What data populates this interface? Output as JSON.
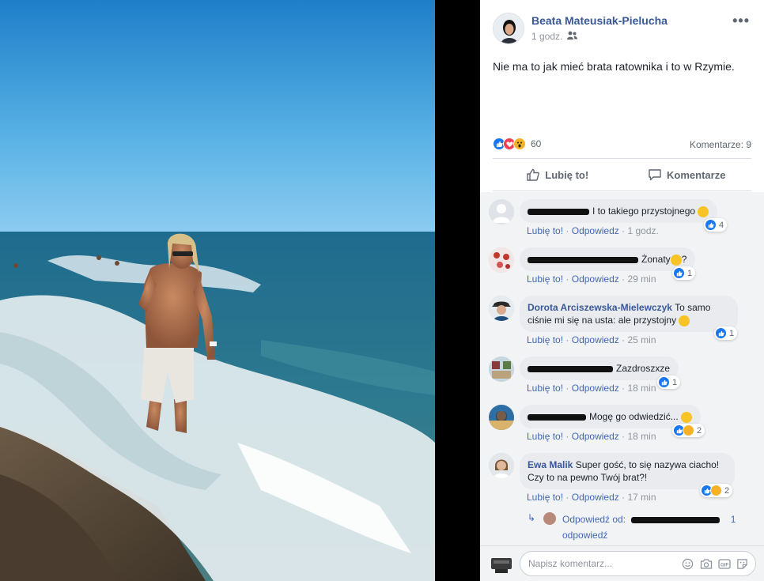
{
  "post": {
    "author": "Beata Mateusiak-Pielucha",
    "time": "1 godz.",
    "text": "Nie ma to jak mieć brata ratownika i to w Rzymie.",
    "reactions_count": "60",
    "comments_label": "Komentarze: 9",
    "like_label": "Lubię to!",
    "comment_label": "Komentarze"
  },
  "comments": [
    {
      "name": "",
      "text": "I to takiego przystojnego",
      "time": "1 godz.",
      "reactions": "4"
    },
    {
      "name": "",
      "text": "Żonaty",
      "suffix": "?",
      "time": "29 min",
      "reactions": "1"
    },
    {
      "name": "Dorota Arciszewska-Mielewczyk",
      "text": "To samo ciśnie mi się na usta: ale przystojny",
      "time": "25 min",
      "reactions": "1"
    },
    {
      "name": "",
      "text": "Zazdroszxze",
      "time": "18 min",
      "reactions": "1"
    },
    {
      "name": "",
      "text": "Mogę go odwiedzić...",
      "time": "18 min",
      "reactions": "2"
    },
    {
      "name": "Ewa Malik",
      "text": "Super gość, to się nazywa ciacho! Czy to na pewno Twój brat?!",
      "time": "17 min",
      "reactions": "2"
    }
  ],
  "comment_actions": {
    "like": "Lubię to!",
    "reply": "Odpowiedz",
    "sep": "·"
  },
  "reply_thread": {
    "prefix": "Odpowiedź od:",
    "count": "1",
    "label": "odpowiedź"
  },
  "composer": {
    "placeholder": "Napisz komentarz..."
  },
  "colors": {
    "link": "#385898",
    "like": "#1877f2"
  }
}
